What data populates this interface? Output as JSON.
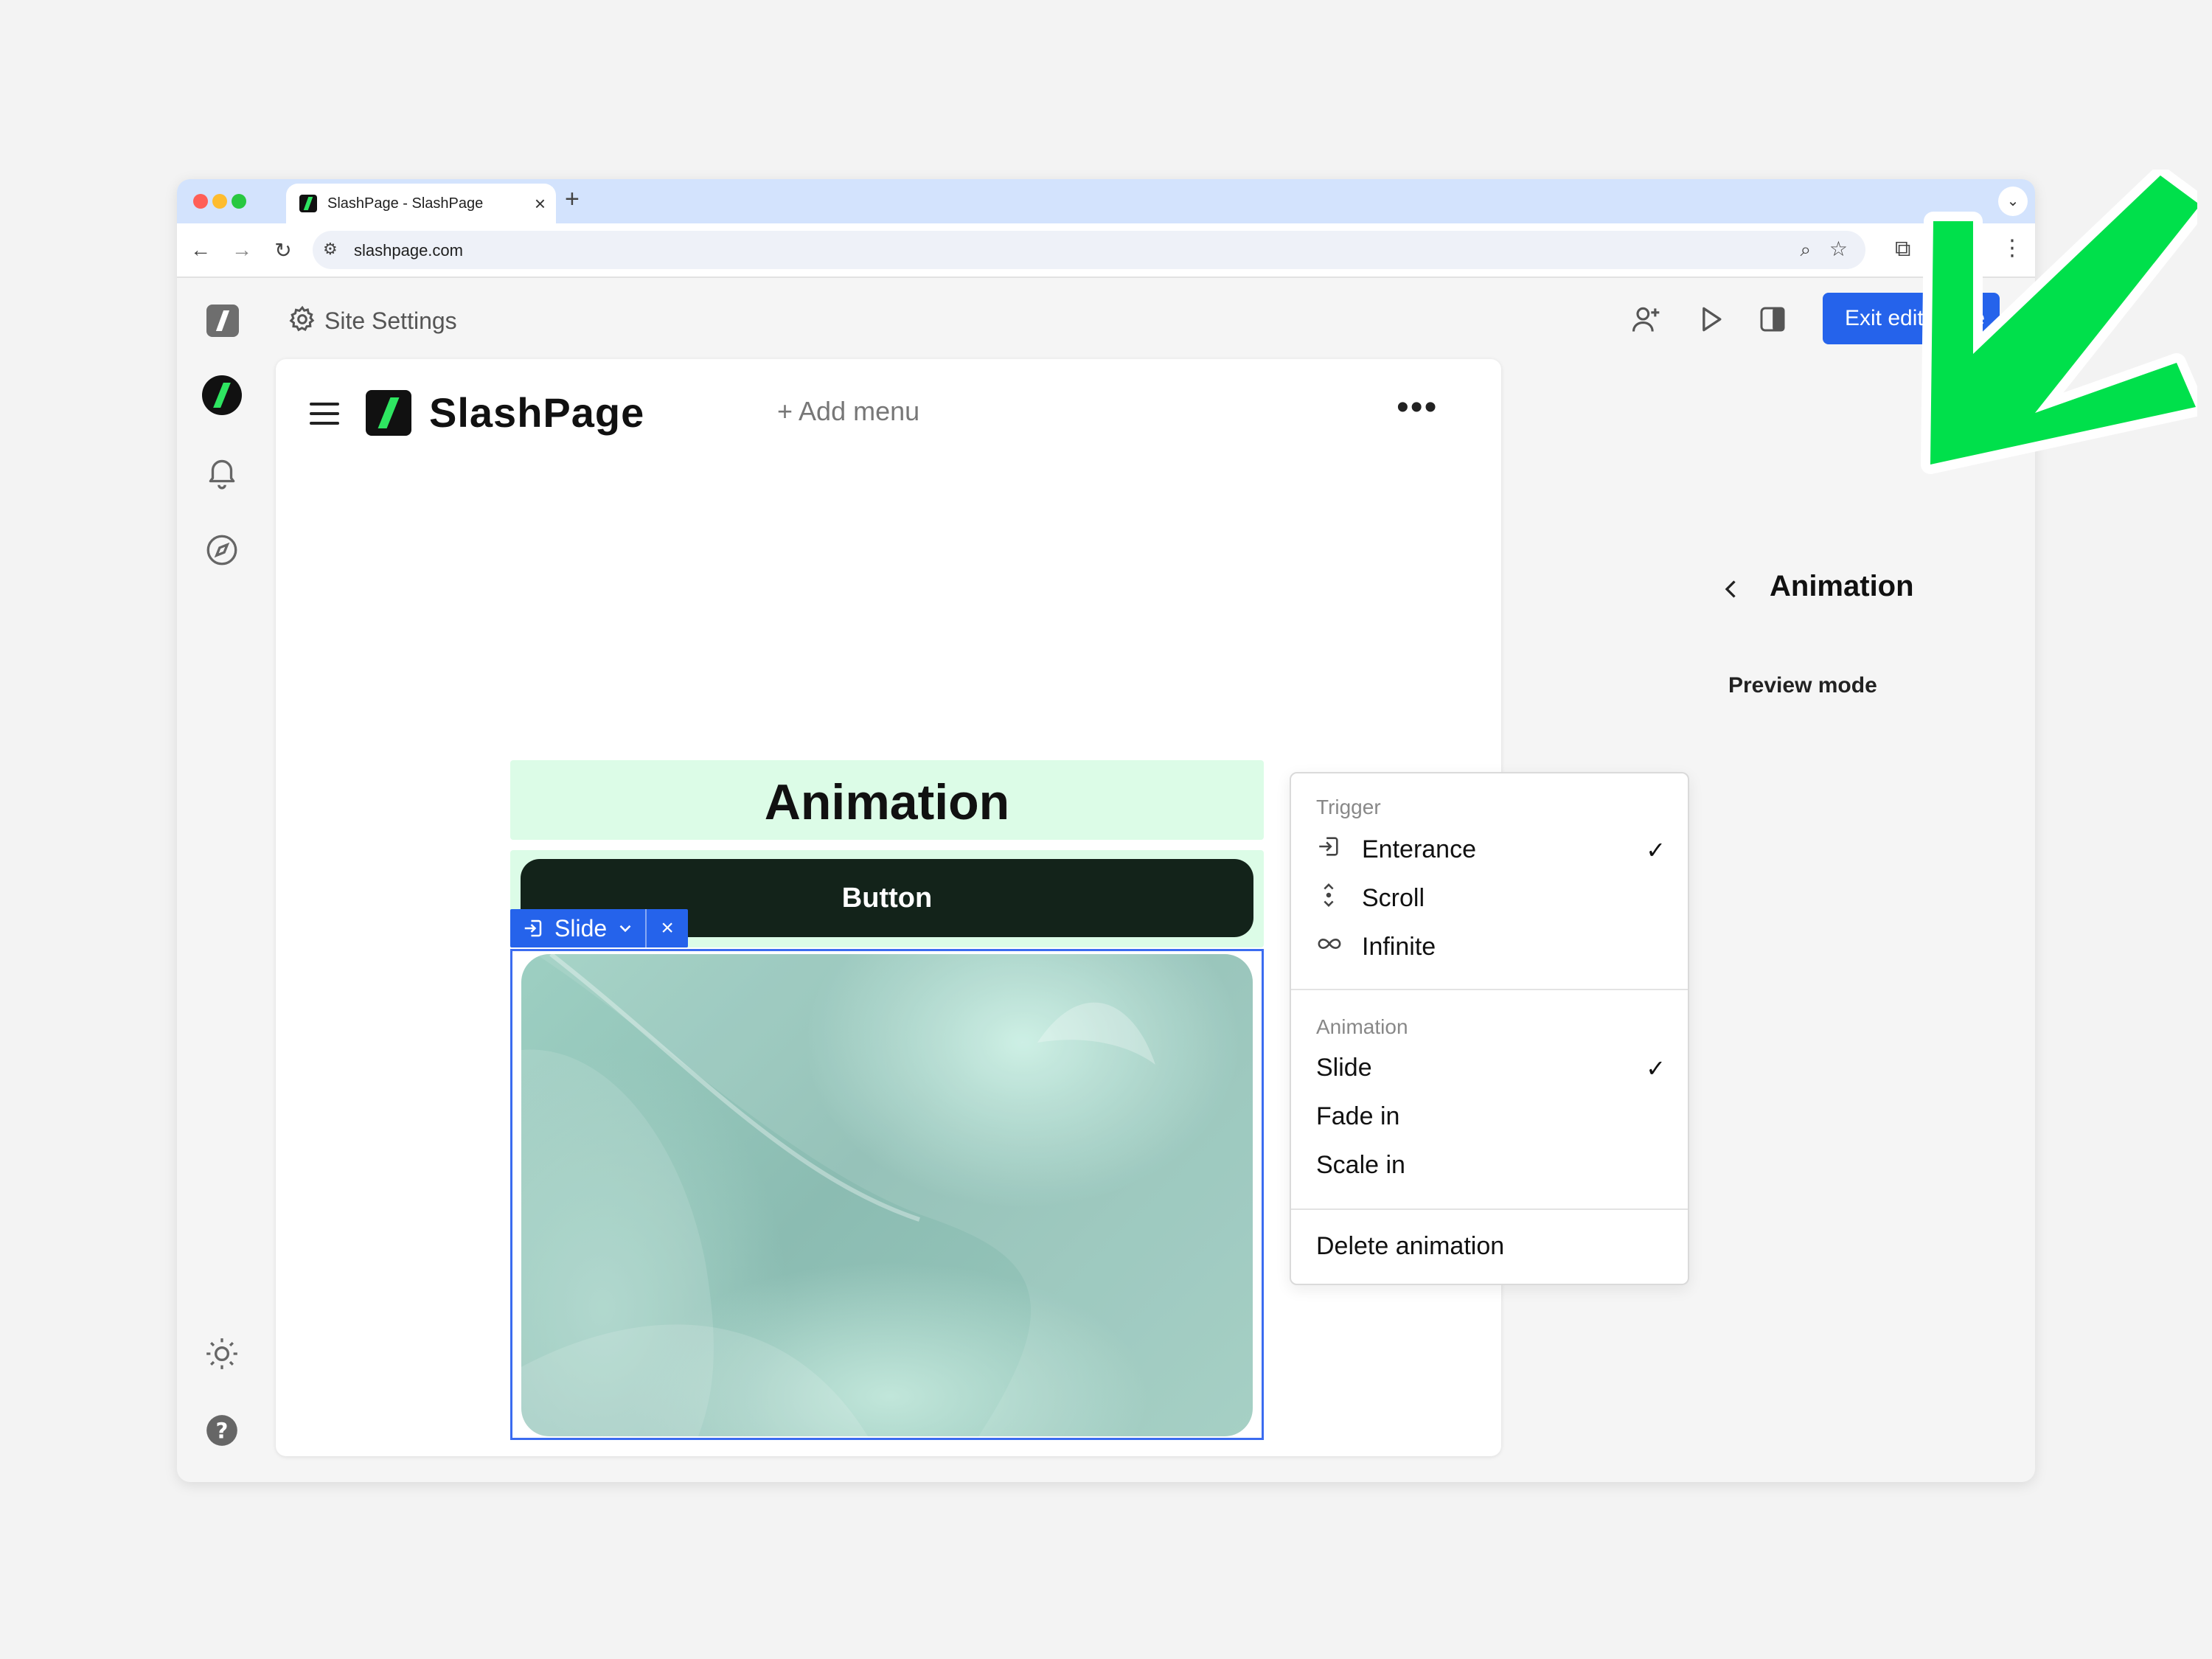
{
  "browser": {
    "tab_title": "SlashPage - SlashPage",
    "tab_close": "×",
    "new_tab": "+",
    "url": "slashpage.com"
  },
  "app_bar": {
    "site_settings": "Site Settings",
    "exit_button": "Exit edit mode",
    "accent_color": "#2563eb"
  },
  "canvas": {
    "brand_name": "SlashPage",
    "add_menu": "+ Add menu",
    "more": "•••",
    "heading": "Animation",
    "button_label": "Button",
    "selection_chip": "Slide",
    "selection_close": "×",
    "block_highlight_color": "#dcfce7"
  },
  "dropdown": {
    "trigger_title": "Trigger",
    "trigger_items": [
      {
        "label": "Enterance",
        "icon": "enter-icon",
        "checked": true
      },
      {
        "label": "Scroll",
        "icon": "scroll-icon",
        "checked": false
      },
      {
        "label": "Infinite",
        "icon": "infinity-icon",
        "checked": false
      }
    ],
    "animation_title": "Animation",
    "animation_items": [
      {
        "label": "Slide",
        "checked": true
      },
      {
        "label": "Fade in",
        "checked": false
      },
      {
        "label": "Scale in",
        "checked": false
      }
    ],
    "delete_label": "Delete animation",
    "check_mark": "✓"
  },
  "panel": {
    "title": "Animation",
    "preview_label": "Preview mode",
    "preview_on": true
  },
  "annotation": {
    "arrow_color": "#00e04b"
  }
}
